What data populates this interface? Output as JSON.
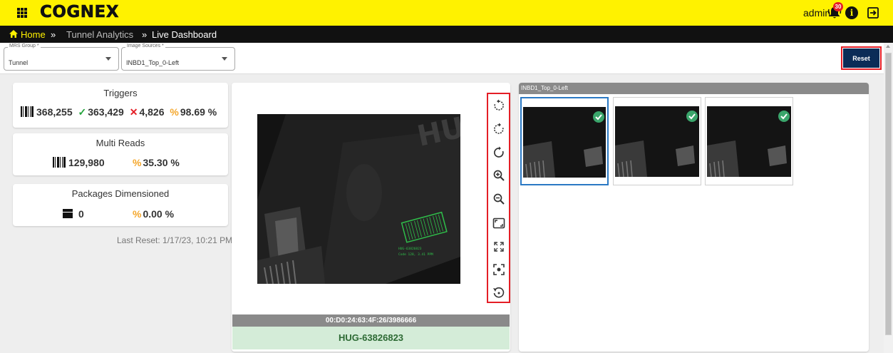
{
  "header": {
    "app_name": "COGNEX",
    "user": "admin",
    "notification_count": "30",
    "colors": {
      "bar": "#fff200",
      "badge": "#e41e26"
    }
  },
  "breadcrumb": {
    "home": "Home",
    "sep": "»",
    "section": "Tunnel Analytics",
    "page": "Live Dashboard"
  },
  "filters": {
    "mrs_group": {
      "label": "MRS Group *",
      "value": "Tunnel"
    },
    "image_sources": {
      "label": "Image Sources *",
      "value": "INBD1_Top_0-Left"
    },
    "reset_label": "Reset"
  },
  "stats": {
    "triggers": {
      "title": "Triggers",
      "total": "368,255",
      "good": "363,429",
      "bad": "4,826",
      "rate": "98.69 %"
    },
    "multi_reads": {
      "title": "Multi Reads",
      "total": "129,980",
      "rate": "35.30 %"
    },
    "packages": {
      "title": "Packages Dimensioned",
      "total": "0",
      "rate": "0.00 %"
    },
    "last_reset": "Last Reset: 1/17/23, 10:21 PM"
  },
  "viewer": {
    "image_text": "HUG",
    "overlay_code": "HUG-63826823",
    "overlay_detail": "Code 128, 3.41 PPM",
    "tools": [
      "rotate-left-icon",
      "rotate-right-icon",
      "flip-icon",
      "zoom-in-icon",
      "zoom-out-icon",
      "fit-screen-icon",
      "expand-icon",
      "center-focus-icon",
      "reset-view-icon"
    ],
    "device_id": "00:D0:24:63:4F:26/3986666",
    "decoded": "HUG-63826823"
  },
  "thumbnails": {
    "source_title": "INBD1_Top_0-Left",
    "items": [
      {
        "status": "good",
        "selected": true
      },
      {
        "status": "good",
        "selected": false
      },
      {
        "status": "good",
        "selected": false
      }
    ]
  }
}
